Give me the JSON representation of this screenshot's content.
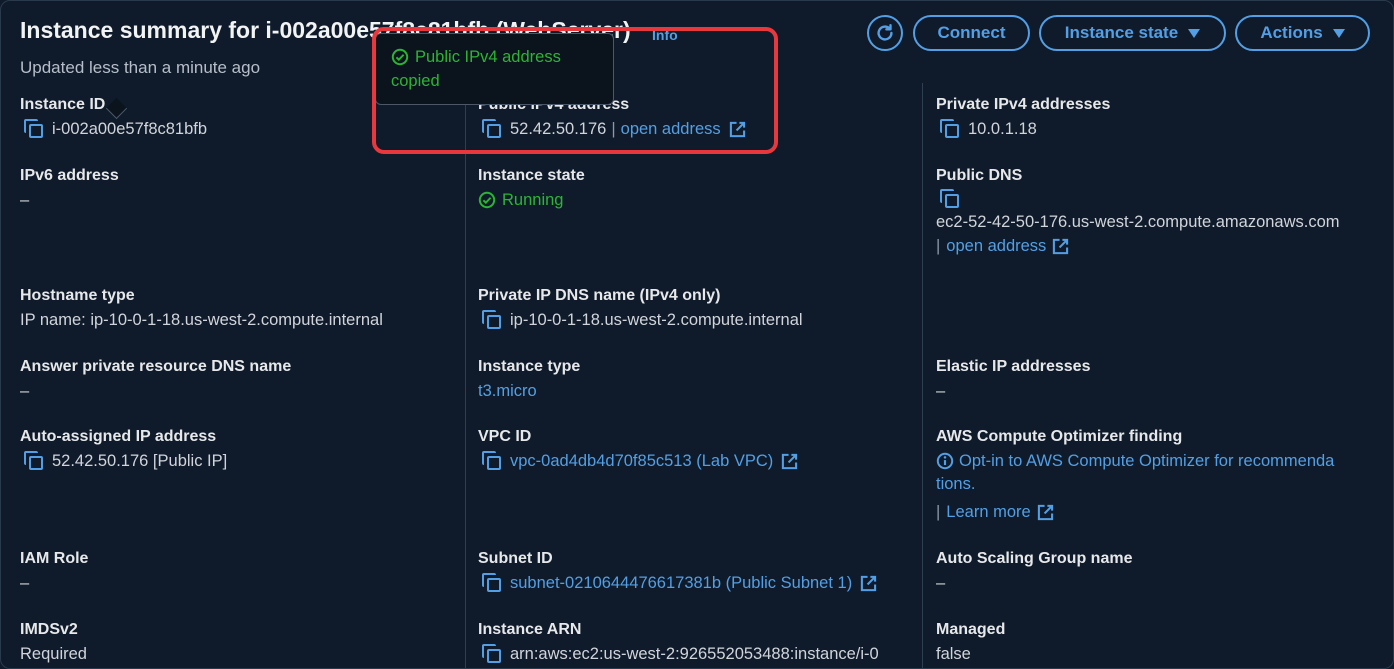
{
  "header": {
    "title": "Instance summary for i-002a00e57f8c81bfb (WebServer)",
    "info": "Info",
    "updated": "Updated less than a minute ago",
    "connect": "Connect",
    "instance_state": "Instance state",
    "actions": "Actions"
  },
  "toast": {
    "message": "Public IPv4 address copied"
  },
  "col1": {
    "instance_id_label": "Instance ID",
    "instance_id": "i-002a00e57f8c81bfb",
    "ipv6_label": "IPv6 address",
    "ipv6": "–",
    "hostname_type_label": "Hostname type",
    "hostname_type": "IP name: ip-10-0-1-18.us-west-2.compute.internal",
    "answer_dns_label": "Answer private resource DNS name",
    "answer_dns": "–",
    "auto_ip_label": "Auto-assigned IP address",
    "auto_ip": "52.42.50.176 [Public IP]",
    "iam_label": "IAM Role",
    "iam": "–",
    "imds_label": "IMDSv2",
    "imds": "Required"
  },
  "col2": {
    "public_ipv4_label": "Public IPv4 address",
    "public_ipv4": "52.42.50.176",
    "open_address": "open address",
    "state_label": "Instance state",
    "state": "Running",
    "private_dns_label": "Private IP DNS name (IPv4 only)",
    "private_dns": "ip-10-0-1-18.us-west-2.compute.internal",
    "type_label": "Instance type",
    "type": "t3.micro",
    "vpc_label": "VPC ID",
    "vpc": "vpc-0ad4db4d70f85c513 (Lab VPC)",
    "subnet_label": "Subnet ID",
    "subnet": "subnet-0210644476617381b (Public Subnet 1)",
    "arn_label": "Instance ARN",
    "arn": "arn:aws:ec2:us-west-2:926552053488:instance/i-0"
  },
  "col3": {
    "private_ipv4_label": "Private IPv4 addresses",
    "private_ipv4": "10.0.1.18",
    "public_dns_label": "Public DNS",
    "public_dns": "ec2-52-42-50-176.us-west-2.compute.amazonaws.com",
    "open_address": "open address",
    "elastic_label": "Elastic IP addresses",
    "elastic": "–",
    "optimizer_label": "AWS Compute Optimizer finding",
    "optimizer_line1": "Opt-in to AWS Compute Optimizer for recommenda",
    "optimizer_line2": "tions.",
    "learn_more": "Learn more",
    "asg_label": "Auto Scaling Group name",
    "asg": "–",
    "managed_label": "Managed",
    "managed": "false"
  },
  "colors": {
    "accent": "#539fe5",
    "success": "#2bb534",
    "highlight": "#e8383d",
    "background": "#0f1b2a"
  },
  "icons": [
    "refresh-icon",
    "copy-icon",
    "external-link-icon",
    "check-circle-icon",
    "info-circle-icon"
  ]
}
